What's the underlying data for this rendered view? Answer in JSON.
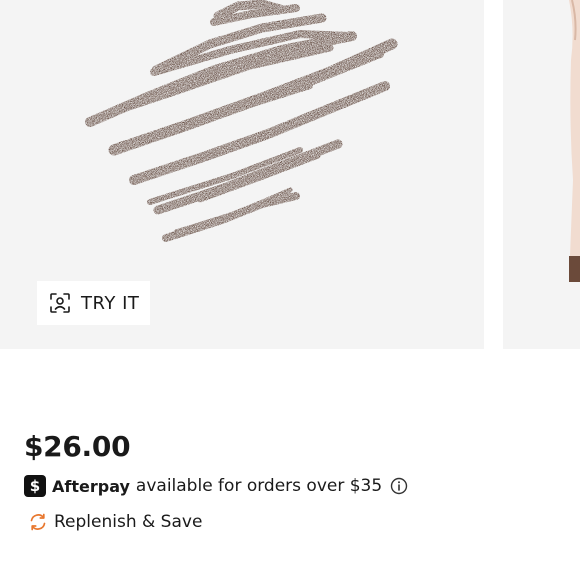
{
  "product_gallery": {
    "try_it_label": "TRY IT",
    "swatch_color": "#4a2e22",
    "next_slide_accent": "#6b4a3a"
  },
  "pricing": {
    "price": "$26.00",
    "afterpay": {
      "logo_glyph": "$",
      "brand": "Afterpay",
      "text": "available for orders over $35"
    },
    "replenish": {
      "label": "Replenish & Save",
      "icon_color": "#e8772e"
    }
  },
  "icons": {
    "try_it": "face-scan-icon",
    "info": "info-icon",
    "replenish": "refresh-icon"
  }
}
